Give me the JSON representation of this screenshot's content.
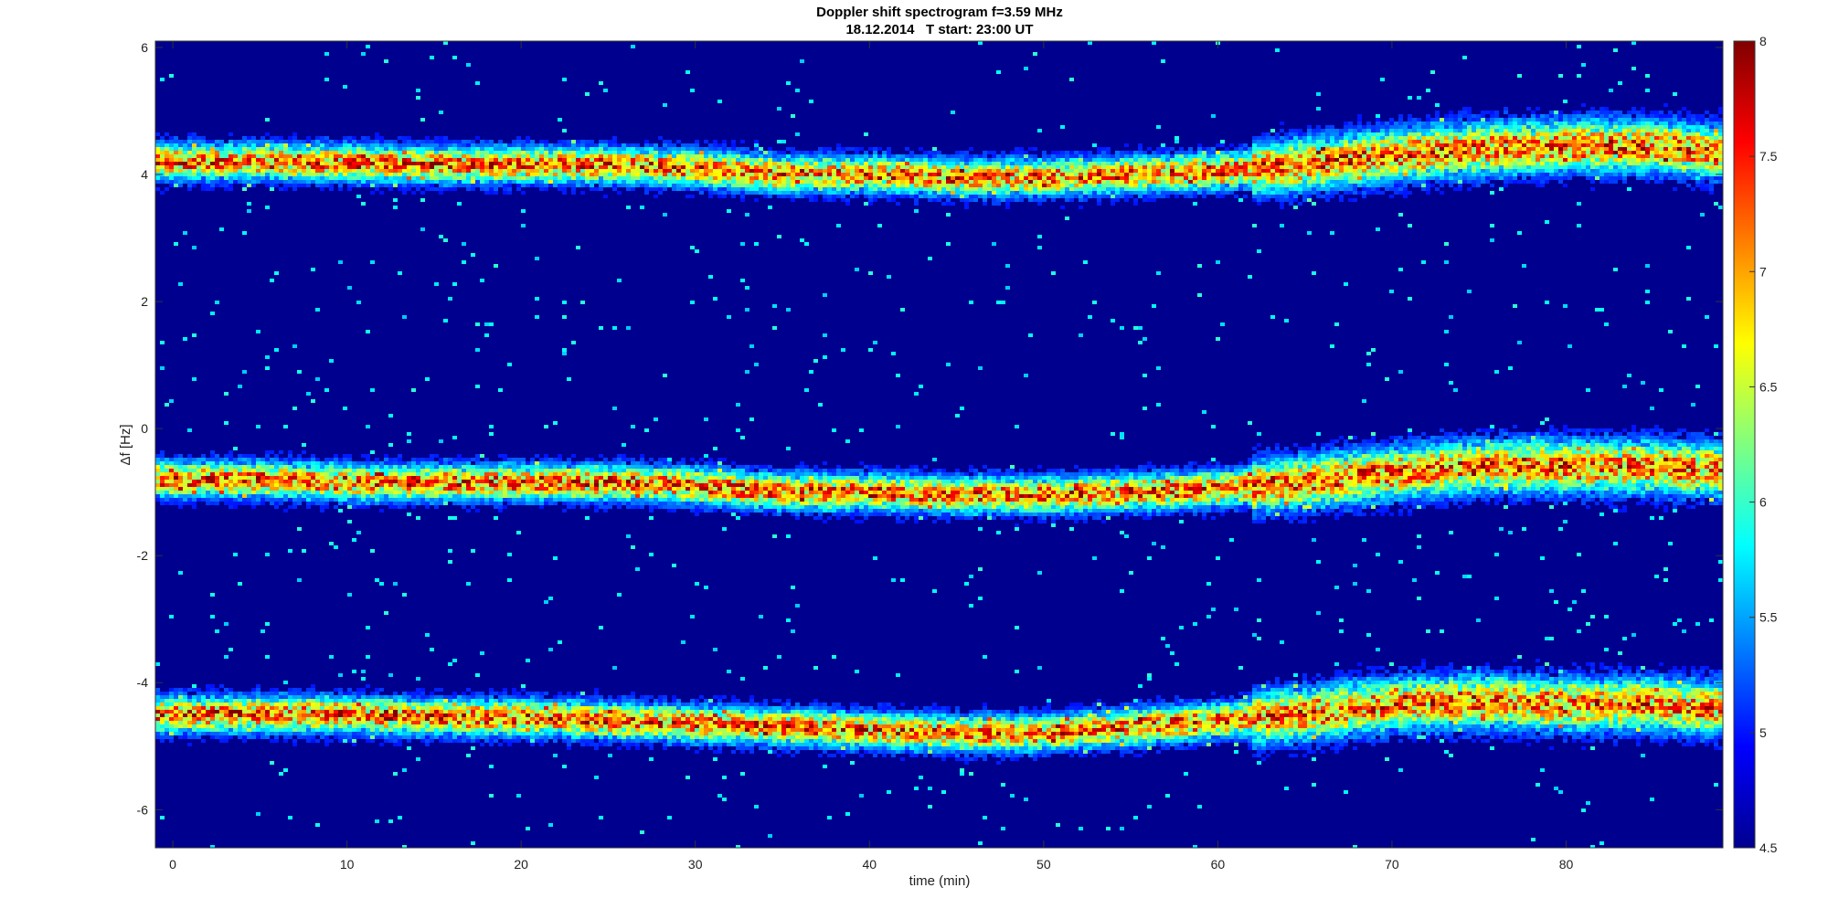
{
  "chart_data": {
    "type": "heatmap",
    "title": "Doppler shift spectrogram f=3.59 MHz",
    "subtitle": "18.12.2014   T start: 23:00 UT",
    "xlabel": "time (min)",
    "ylabel": "Δf [Hz]",
    "xlim": [
      -1,
      89
    ],
    "ylim": [
      -6.6,
      6.1
    ],
    "x_ticks": [
      0,
      10,
      20,
      30,
      40,
      50,
      60,
      70,
      80
    ],
    "y_ticks": [
      -6,
      -4,
      -2,
      0,
      2,
      4,
      6
    ],
    "colorbar": {
      "colormap": "jet",
      "range": [
        4.5,
        8
      ],
      "ticks": [
        4.5,
        5,
        5.5,
        6,
        6.5,
        7,
        7.5,
        8
      ]
    },
    "grid": false,
    "traces": [
      {
        "band": "upper",
        "x": [
          0,
          5,
          10,
          15,
          20,
          25,
          30,
          35,
          40,
          45,
          50,
          55,
          60,
          65,
          70,
          75,
          80,
          85,
          88
        ],
        "y": [
          4.2,
          4.2,
          4.18,
          4.15,
          4.15,
          4.15,
          4.1,
          4.0,
          4.0,
          3.95,
          3.95,
          4.0,
          4.05,
          4.15,
          4.3,
          4.4,
          4.45,
          4.45,
          4.35
        ]
      },
      {
        "band": "middle",
        "x": [
          0,
          5,
          10,
          15,
          20,
          25,
          30,
          35,
          40,
          45,
          50,
          55,
          60,
          65,
          70,
          75,
          80,
          85,
          88
        ],
        "y": [
          -0.8,
          -0.8,
          -0.85,
          -0.85,
          -0.85,
          -0.85,
          -0.9,
          -1.0,
          -1.0,
          -1.05,
          -1.05,
          -1.0,
          -0.95,
          -0.85,
          -0.7,
          -0.6,
          -0.6,
          -0.6,
          -0.65
        ]
      },
      {
        "band": "lower",
        "x": [
          0,
          5,
          10,
          15,
          20,
          25,
          30,
          35,
          40,
          45,
          50,
          55,
          60,
          65,
          70,
          75,
          80,
          85,
          88
        ],
        "y": [
          -4.5,
          -4.5,
          -4.5,
          -4.55,
          -4.55,
          -4.6,
          -4.65,
          -4.7,
          -4.75,
          -4.8,
          -4.8,
          -4.7,
          -4.6,
          -4.5,
          -4.35,
          -4.3,
          -4.35,
          -4.35,
          -4.4
        ]
      }
    ]
  }
}
